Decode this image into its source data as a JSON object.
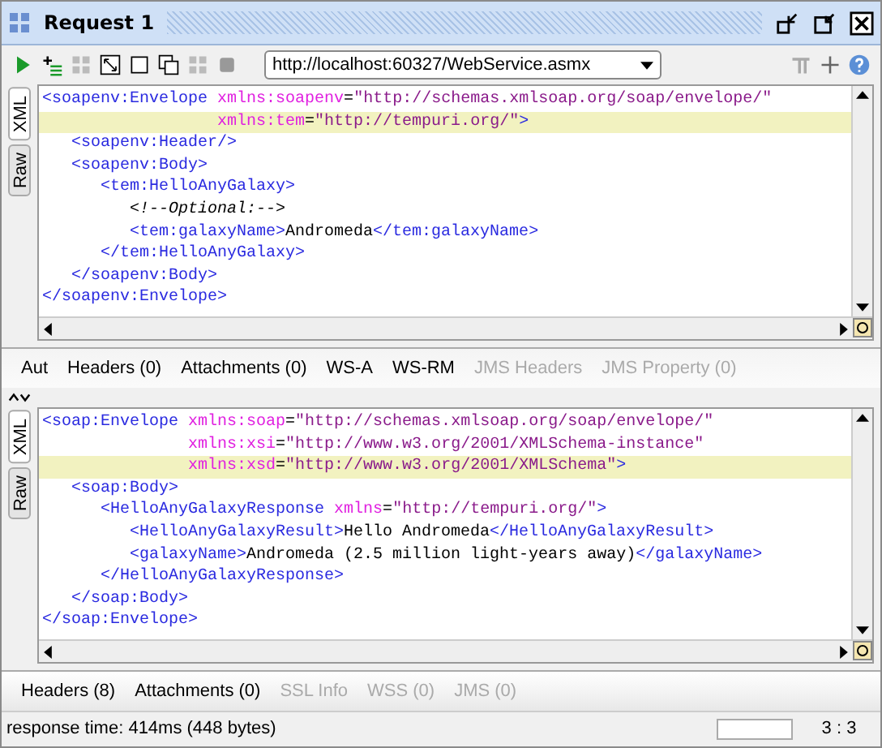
{
  "window": {
    "title": "Request 1"
  },
  "toolbar": {
    "url": "http://localhost:60327/WebService.asmx"
  },
  "request_editor": {
    "side_tabs": [
      {
        "label": "XML",
        "selected": true
      },
      {
        "label": "Raw",
        "selected": false
      }
    ],
    "lines": [
      {
        "highlighted": false,
        "tokens": [
          {
            "kind": "tag",
            "text": "<soapenv:Envelope "
          },
          {
            "kind": "attr",
            "text": "xmlns:soapenv"
          },
          {
            "kind": "text",
            "text": "="
          },
          {
            "kind": "value",
            "text": "\"http://schemas.xmlsoap.org/soap/envelope/\""
          }
        ]
      },
      {
        "highlighted": true,
        "tokens": [
          {
            "kind": "attr",
            "text": "                  xmlns:tem"
          },
          {
            "kind": "text",
            "text": "="
          },
          {
            "kind": "value",
            "text": "\"http://tempuri.org/\""
          },
          {
            "kind": "tag",
            "text": ">"
          }
        ]
      },
      {
        "highlighted": false,
        "tokens": [
          {
            "kind": "tag",
            "text": "   <soapenv:Header/>"
          }
        ]
      },
      {
        "highlighted": false,
        "tokens": [
          {
            "kind": "tag",
            "text": "   <soapenv:Body>"
          }
        ]
      },
      {
        "highlighted": false,
        "tokens": [
          {
            "kind": "tag",
            "text": "      <tem:HelloAnyGalaxy>"
          }
        ]
      },
      {
        "highlighted": false,
        "tokens": [
          {
            "kind": "comment",
            "text": "         <!--Optional:-->"
          }
        ]
      },
      {
        "highlighted": false,
        "tokens": [
          {
            "kind": "tag",
            "text": "         <tem:galaxyName>"
          },
          {
            "kind": "text",
            "text": "Andromeda"
          },
          {
            "kind": "tag",
            "text": "</tem:galaxyName>"
          }
        ]
      },
      {
        "highlighted": false,
        "tokens": [
          {
            "kind": "tag",
            "text": "      </tem:HelloAnyGalaxy>"
          }
        ]
      },
      {
        "highlighted": false,
        "tokens": [
          {
            "kind": "tag",
            "text": "   </soapenv:Body>"
          }
        ]
      },
      {
        "highlighted": false,
        "tokens": [
          {
            "kind": "tag",
            "text": "</soapenv:Envelope>"
          }
        ]
      }
    ]
  },
  "request_tabs": [
    {
      "label": "Aut",
      "disabled": false
    },
    {
      "label": "Headers (0)",
      "disabled": false
    },
    {
      "label": "Attachments (0)",
      "disabled": false
    },
    {
      "label": "WS-A",
      "disabled": false
    },
    {
      "label": "WS-RM",
      "disabled": false
    },
    {
      "label": "JMS Headers",
      "disabled": true
    },
    {
      "label": "JMS Property (0)",
      "disabled": true
    }
  ],
  "response_editor": {
    "side_tabs": [
      {
        "label": "XML",
        "selected": true
      },
      {
        "label": "Raw",
        "selected": false
      }
    ],
    "lines": [
      {
        "highlighted": false,
        "tokens": [
          {
            "kind": "tag",
            "text": "<soap:Envelope "
          },
          {
            "kind": "attr",
            "text": "xmlns:soap"
          },
          {
            "kind": "text",
            "text": "="
          },
          {
            "kind": "value",
            "text": "\"http://schemas.xmlsoap.org/soap/envelope/\""
          }
        ]
      },
      {
        "highlighted": false,
        "tokens": [
          {
            "kind": "attr",
            "text": "               xmlns:xsi"
          },
          {
            "kind": "text",
            "text": "="
          },
          {
            "kind": "value",
            "text": "\"http://www.w3.org/2001/XMLSchema-instance\""
          }
        ]
      },
      {
        "highlighted": true,
        "tokens": [
          {
            "kind": "attr",
            "text": "               xmlns:xsd"
          },
          {
            "kind": "text",
            "text": "="
          },
          {
            "kind": "value",
            "text": "\"http://www.w3.org/2001/XMLSchema\""
          },
          {
            "kind": "tag",
            "text": ">"
          }
        ]
      },
      {
        "highlighted": false,
        "tokens": [
          {
            "kind": "tag",
            "text": "   <soap:Body>"
          }
        ]
      },
      {
        "highlighted": false,
        "tokens": [
          {
            "kind": "tag",
            "text": "      <HelloAnyGalaxyResponse "
          },
          {
            "kind": "attr",
            "text": "xmlns"
          },
          {
            "kind": "text",
            "text": "="
          },
          {
            "kind": "value",
            "text": "\"http://tempuri.org/\""
          },
          {
            "kind": "tag",
            "text": ">"
          }
        ]
      },
      {
        "highlighted": false,
        "tokens": [
          {
            "kind": "tag",
            "text": "         <HelloAnyGalaxyResult>"
          },
          {
            "kind": "text",
            "text": "Hello Andromeda"
          },
          {
            "kind": "tag",
            "text": "</HelloAnyGalaxyResult>"
          }
        ]
      },
      {
        "highlighted": false,
        "tokens": [
          {
            "kind": "tag",
            "text": "         <galaxyName>"
          },
          {
            "kind": "text",
            "text": "Andromeda (2.5 million light-years away)"
          },
          {
            "kind": "tag",
            "text": "</galaxyName>"
          }
        ]
      },
      {
        "highlighted": false,
        "tokens": [
          {
            "kind": "tag",
            "text": "      </HelloAnyGalaxyResponse>"
          }
        ]
      },
      {
        "highlighted": false,
        "tokens": [
          {
            "kind": "tag",
            "text": "   </soap:Body>"
          }
        ]
      },
      {
        "highlighted": false,
        "tokens": [
          {
            "kind": "tag",
            "text": "</soap:Envelope>"
          }
        ]
      }
    ]
  },
  "response_tabs": [
    {
      "label": "Headers (8)",
      "disabled": false
    },
    {
      "label": "Attachments (0)",
      "disabled": false
    },
    {
      "label": "SSL Info",
      "disabled": true
    },
    {
      "label": "WSS (0)",
      "disabled": true
    },
    {
      "label": "JMS (0)",
      "disabled": true
    }
  ],
  "status_bar": {
    "message": "response time: 414ms (448 bytes)",
    "position": "3 : 3"
  }
}
